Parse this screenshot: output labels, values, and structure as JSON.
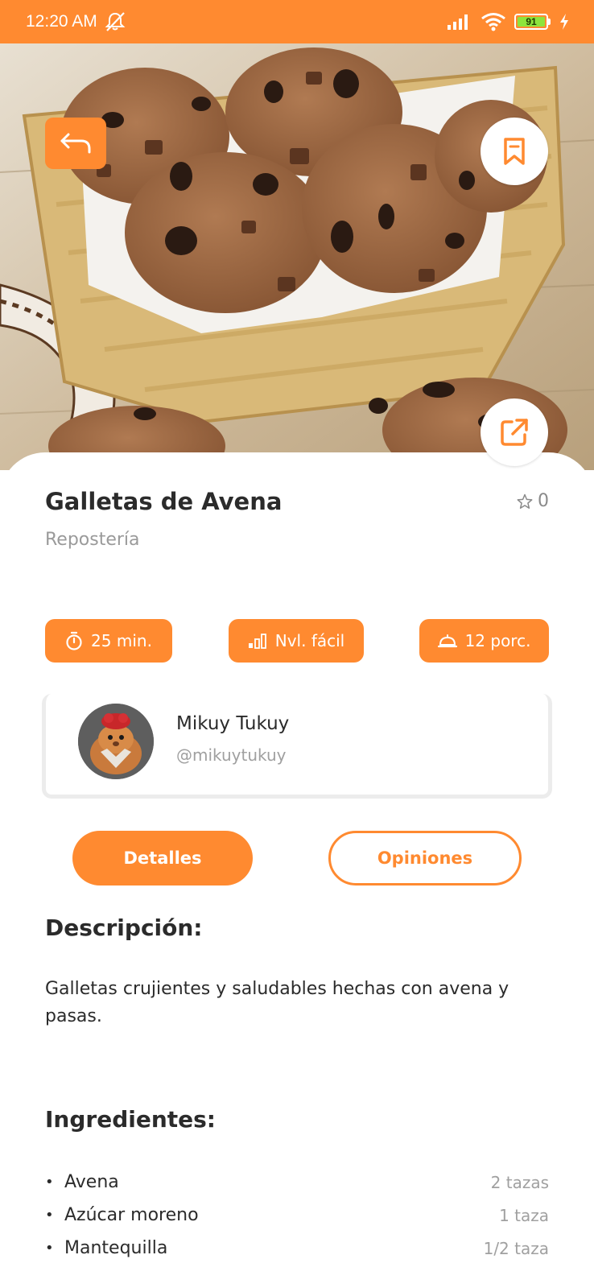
{
  "status_bar": {
    "time": "12:20 AM",
    "battery": "91"
  },
  "recipe": {
    "title": "Galletas de Avena",
    "category": "Repostería",
    "rating": "0",
    "time": "25 min.",
    "level": "Nvl. fácil",
    "servings": "12 porc."
  },
  "author": {
    "name": "Mikuy Tukuy",
    "handle": "@mikuytukuy"
  },
  "tabs": {
    "details": "Detalles",
    "opinions": "Opiniones"
  },
  "description": {
    "title": "Descripción:",
    "text": "Galletas crujientes y saludables hechas con avena y pasas."
  },
  "ingredients": {
    "title": "Ingredientes:",
    "items": [
      {
        "name": "Avena",
        "qty": "2 tazas"
      },
      {
        "name": "Azúcar moreno",
        "qty": "1 taza"
      },
      {
        "name": "Mantequilla",
        "qty": "1/2 taza"
      }
    ]
  },
  "colors": {
    "accent": "#ff8a30",
    "text": "#2b2b2b",
    "muted": "#9a9a9a"
  },
  "icons": {
    "back": "return-arrow-icon",
    "bookmark": "bookmark-icon",
    "share": "external-link-icon",
    "rating": "star-outline-icon",
    "time": "stopwatch-icon",
    "level": "signal-bars-icon",
    "servings": "serving-dish-icon"
  }
}
